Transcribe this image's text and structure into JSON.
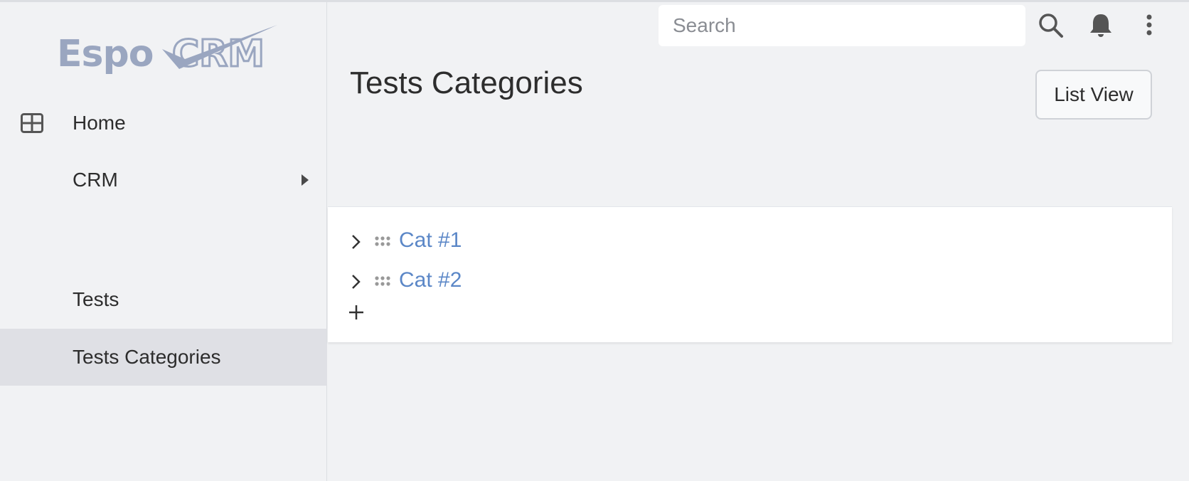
{
  "app": {
    "logo_text": "EspoCRM"
  },
  "sidebar": {
    "items": [
      {
        "label": "Home",
        "icon": "grid-icon"
      },
      {
        "label": "CRM",
        "icon": "caret-right-icon"
      },
      {
        "label": "Tests"
      },
      {
        "label": "Tests Categories",
        "active": true
      }
    ]
  },
  "header": {
    "search_placeholder": "Search",
    "icons": [
      "search-icon",
      "bell-icon",
      "vertical-dots-icon"
    ]
  },
  "page": {
    "title": "Tests Categories",
    "list_view_label": "List View"
  },
  "tree": {
    "items": [
      {
        "label": "Cat #1"
      },
      {
        "label": "Cat #2"
      }
    ],
    "add_icon": "plus-icon"
  },
  "colors": {
    "background": "#f1f2f4",
    "active_nav": "#dfe0e5",
    "link": "#5b87c7",
    "logo": "#9aa6c0"
  }
}
